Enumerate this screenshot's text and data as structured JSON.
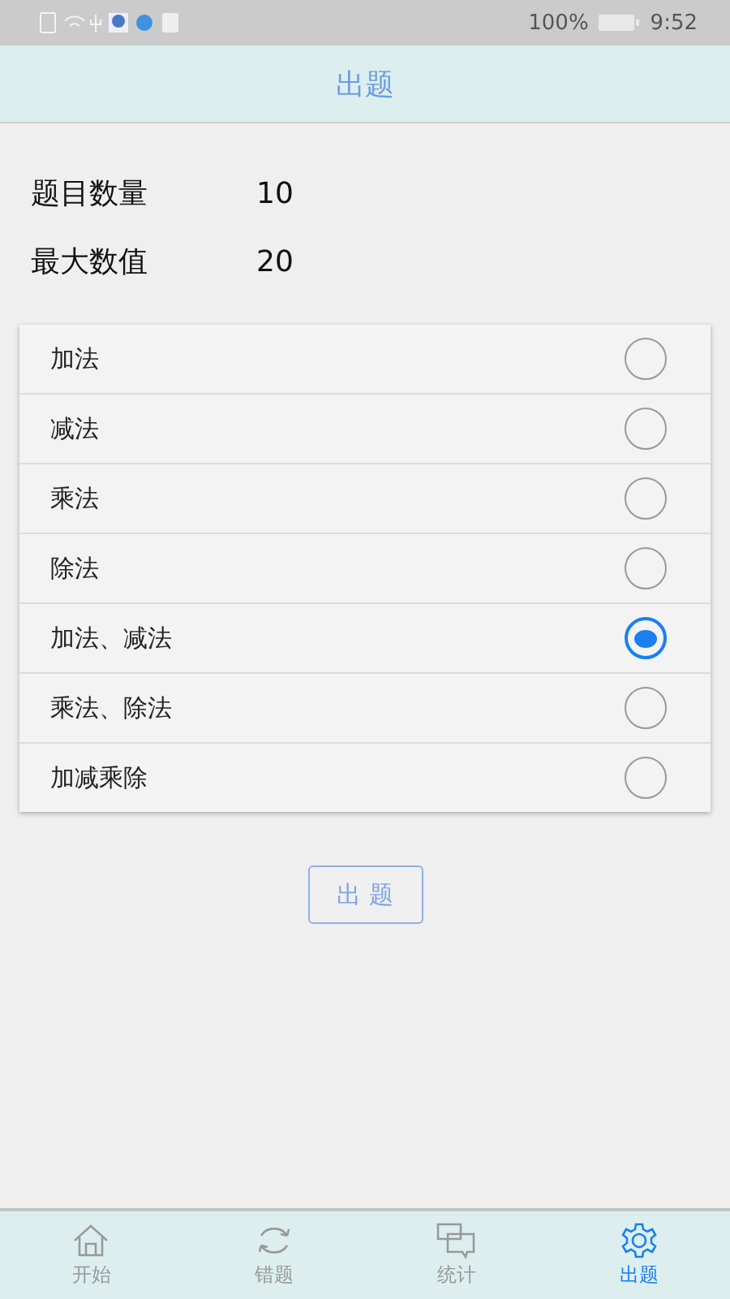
{
  "status_bar": {
    "battery": "100%",
    "time": "9:52"
  },
  "header": {
    "title": "出题"
  },
  "settings": [
    {
      "label": "题目数量",
      "value": "10"
    },
    {
      "label": "最大数值",
      "value": "20"
    }
  ],
  "options": [
    {
      "label": "加法",
      "selected": false
    },
    {
      "label": "减法",
      "selected": false
    },
    {
      "label": "乘法",
      "selected": false
    },
    {
      "label": "除法",
      "selected": false
    },
    {
      "label": "加法、减法",
      "selected": true
    },
    {
      "label": "乘法、除法",
      "selected": false
    },
    {
      "label": "加减乘除",
      "selected": false
    }
  ],
  "submit_button": "出 题",
  "tabs": [
    {
      "label": "开始",
      "kind": "home",
      "selected": false
    },
    {
      "label": "错题",
      "kind": "refresh",
      "selected": false
    },
    {
      "label": "统计",
      "kind": "chat",
      "selected": false
    },
    {
      "label": "出题",
      "kind": "gear",
      "selected": true
    }
  ]
}
